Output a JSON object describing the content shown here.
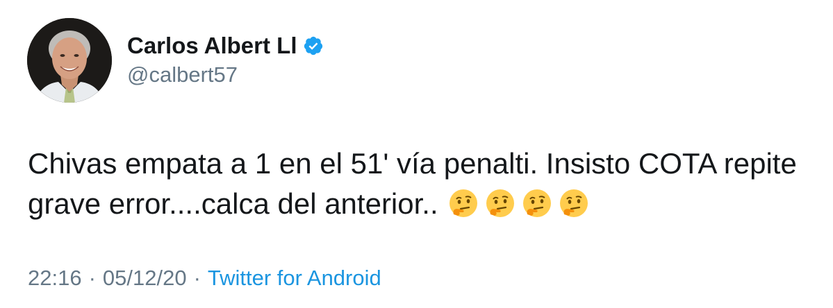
{
  "user": {
    "display_name": "Carlos Albert Ll",
    "handle": "@calbert57",
    "verified": true,
    "avatar_icon": "profile-photo"
  },
  "tweet": {
    "line1": "Chivas empata a 1 en el 51' vía penalti. Insisto COTA repite",
    "line2": "grave error....calca del anterior..",
    "emojis": [
      "thinking-face-icon",
      "thinking-face-icon",
      "thinking-face-icon",
      "thinking-face-icon"
    ]
  },
  "meta": {
    "time": "22:16",
    "separator": "·",
    "date": "05/12/20",
    "source": "Twitter for Android"
  },
  "colors": {
    "text": "#14171a",
    "secondary": "#657786",
    "link": "#1b95e0",
    "verified": "#1da1f2"
  }
}
